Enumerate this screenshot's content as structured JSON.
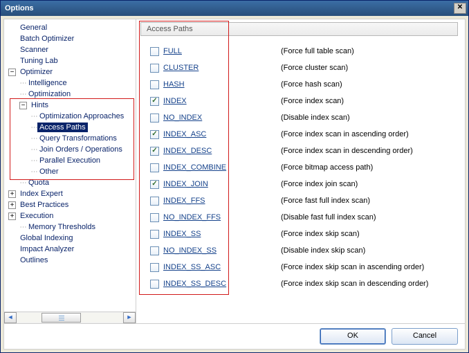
{
  "window": {
    "title": "Options"
  },
  "tree": {
    "items": [
      {
        "label": "General",
        "level": 0,
        "exp": "hidden"
      },
      {
        "label": "Batch Optimizer",
        "level": 0,
        "exp": "hidden"
      },
      {
        "label": "Scanner",
        "level": 0,
        "exp": "hidden"
      },
      {
        "label": "Tuning Lab",
        "level": 0,
        "exp": "hidden"
      },
      {
        "label": "Optimizer",
        "level": 0,
        "exp": "minus"
      },
      {
        "label": "Intelligence",
        "level": 1,
        "exp": "leaf"
      },
      {
        "label": "Optimization",
        "level": 1,
        "exp": "leaf"
      },
      {
        "label": "Hints",
        "level": 1,
        "exp": "minus",
        "red": true
      },
      {
        "label": "Optimization Approaches",
        "level": 2,
        "exp": "leaf",
        "red": true
      },
      {
        "label": "Access Paths",
        "level": 2,
        "exp": "leaf",
        "red": true,
        "selected": true
      },
      {
        "label": "Query Transformations",
        "level": 2,
        "exp": "leaf",
        "red": true
      },
      {
        "label": "Join Orders / Operations",
        "level": 2,
        "exp": "leaf",
        "red": true
      },
      {
        "label": "Parallel Execution",
        "level": 2,
        "exp": "leaf",
        "red": true
      },
      {
        "label": "Other",
        "level": 2,
        "exp": "leaf",
        "red": true
      },
      {
        "label": "Quota",
        "level": 1,
        "exp": "leaf"
      },
      {
        "label": "Index Expert",
        "level": 0,
        "exp": "plus"
      },
      {
        "label": "Best Practices",
        "level": 0,
        "exp": "plus"
      },
      {
        "label": "Execution",
        "level": 0,
        "exp": "plus"
      },
      {
        "label": "Memory Thresholds",
        "level": 1,
        "exp": "leaf"
      },
      {
        "label": "Global Indexing",
        "level": 0,
        "exp": "hidden"
      },
      {
        "label": "Impact Analyzer",
        "level": 0,
        "exp": "hidden"
      },
      {
        "label": "Outlines",
        "level": 0,
        "exp": "hidden"
      }
    ]
  },
  "content": {
    "header": "Access Paths",
    "hints": [
      {
        "name": "FULL",
        "checked": false,
        "desc": "(Force full table scan)"
      },
      {
        "name": "CLUSTER",
        "checked": false,
        "desc": "(Force cluster scan)"
      },
      {
        "name": "HASH",
        "checked": false,
        "desc": "(Force hash scan)"
      },
      {
        "name": "INDEX",
        "checked": true,
        "desc": "(Force index scan)"
      },
      {
        "name": "NO_INDEX",
        "checked": false,
        "desc": "(Disable index scan)"
      },
      {
        "name": "INDEX_ASC",
        "checked": true,
        "desc": "(Force index scan in ascending order)"
      },
      {
        "name": "INDEX_DESC",
        "checked": true,
        "desc": "(Force index scan in descending order)"
      },
      {
        "name": "INDEX_COMBINE",
        "checked": false,
        "desc": "(Force bitmap access path)"
      },
      {
        "name": "INDEX_JOIN",
        "checked": true,
        "desc": "(Force index join scan)"
      },
      {
        "name": "INDEX_FFS",
        "checked": false,
        "desc": "(Force fast full index scan)"
      },
      {
        "name": "NO_INDEX_FFS",
        "checked": false,
        "desc": "(Disable fast full index scan)"
      },
      {
        "name": "INDEX_SS",
        "checked": false,
        "desc": "(Force index skip scan)"
      },
      {
        "name": "NO_INDEX_SS",
        "checked": false,
        "desc": "(Disable index skip scan)"
      },
      {
        "name": "INDEX_SS_ASC",
        "checked": false,
        "desc": "(Force index skip scan in ascending order)"
      },
      {
        "name": "INDEX_SS_DESC",
        "checked": false,
        "desc": "(Force index skip scan in descending order)"
      }
    ]
  },
  "buttons": {
    "ok": "OK",
    "cancel": "Cancel"
  }
}
